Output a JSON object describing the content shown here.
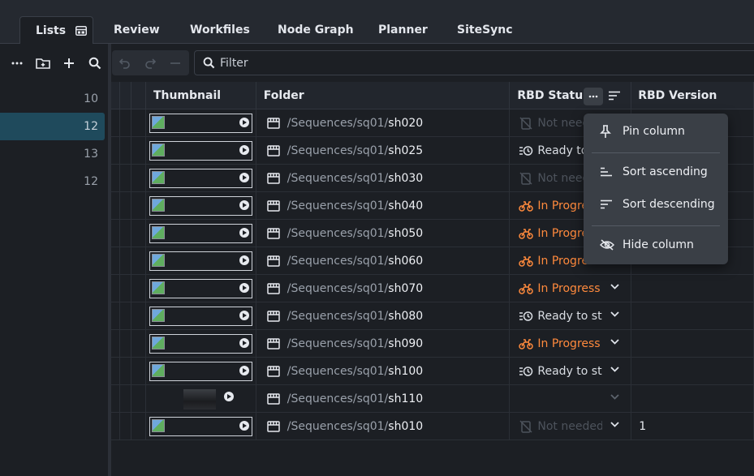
{
  "tabs": [
    {
      "label": "Lists",
      "active": true
    },
    {
      "label": "Review"
    },
    {
      "label": "Workfiles"
    },
    {
      "label": "Node Graph"
    },
    {
      "label": "Planner"
    },
    {
      "label": "SiteSync"
    }
  ],
  "left_panel": {
    "tools": [
      "more-icon",
      "add-folder-icon",
      "plus-icon",
      "search-icon"
    ],
    "rows": [
      {
        "count": "10",
        "selected": false
      },
      {
        "count": "12",
        "selected": true
      },
      {
        "count": "13",
        "selected": false
      },
      {
        "count": "12",
        "selected": false
      }
    ]
  },
  "toolbar": {
    "filter_label": "Filter"
  },
  "table": {
    "columns": {
      "thumbnail": "Thumbnail",
      "folder": "Folder",
      "status": "RBD Status",
      "version": "RBD Version"
    },
    "rows": [
      {
        "path": "/Sequences/sq01/",
        "shot": "sh020",
        "status": "Not needed",
        "status_type": "none",
        "version": ""
      },
      {
        "path": "/Sequences/sq01/",
        "shot": "sh025",
        "status": "Ready to start",
        "status_type": "ready",
        "version": ""
      },
      {
        "path": "/Sequences/sq01/",
        "shot": "sh030",
        "status": "Not needed",
        "status_type": "none",
        "version": ""
      },
      {
        "path": "/Sequences/sq01/",
        "shot": "sh040",
        "status": "In Progress",
        "status_type": "progress",
        "version": ""
      },
      {
        "path": "/Sequences/sq01/",
        "shot": "sh050",
        "status": "In Progress",
        "status_type": "progress",
        "version": ""
      },
      {
        "path": "/Sequences/sq01/",
        "shot": "sh060",
        "status": "In Progress",
        "status_type": "progress",
        "version": ""
      },
      {
        "path": "/Sequences/sq01/",
        "shot": "sh070",
        "status": "In Progress",
        "status_type": "progress",
        "version": ""
      },
      {
        "path": "/Sequences/sq01/",
        "shot": "sh080",
        "status": "Ready to start",
        "status_type": "ready",
        "version": ""
      },
      {
        "path": "/Sequences/sq01/",
        "shot": "sh090",
        "status": "In Progress",
        "status_type": "progress",
        "version": ""
      },
      {
        "path": "/Sequences/sq01/",
        "shot": "sh100",
        "status": "Ready to start",
        "status_type": "ready",
        "version": ""
      },
      {
        "path": "/Sequences/sq01/",
        "shot": "sh110",
        "status": "",
        "status_type": "empty",
        "version": "",
        "real_thumb": true
      },
      {
        "path": "/Sequences/sq01/",
        "shot": "sh010",
        "status": "Not needed",
        "status_type": "none",
        "version": "1"
      }
    ]
  },
  "context_menu": {
    "items": [
      {
        "label": "Pin column",
        "icon": "pin-icon"
      },
      {
        "label": "Sort ascending",
        "icon": "sort-ascending-icon"
      },
      {
        "label": "Sort descending",
        "icon": "sort-descending-icon"
      },
      {
        "label": "Hide column",
        "icon": "eye-off-icon"
      }
    ]
  },
  "colors": {
    "in_progress": "#ff8a3d",
    "selected_row": "#1f4a5c",
    "background": "#1c1f24"
  }
}
